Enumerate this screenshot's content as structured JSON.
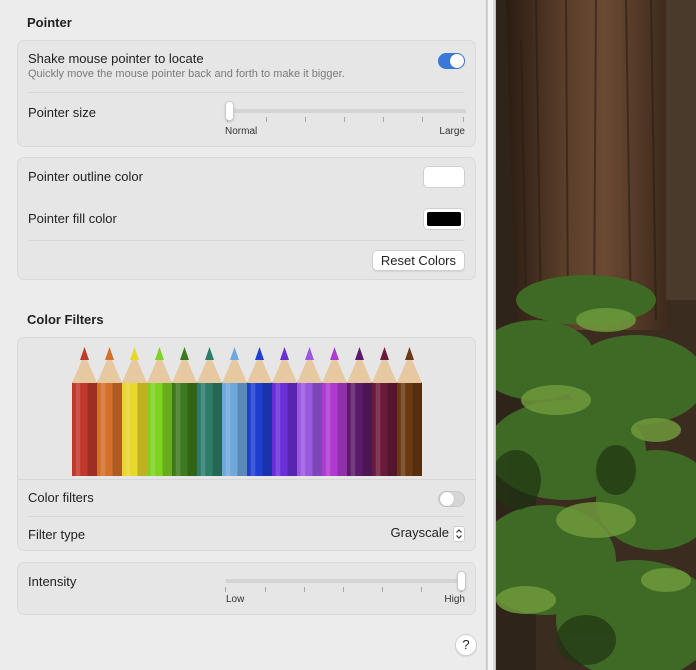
{
  "pointer": {
    "title": "Pointer",
    "shake": {
      "label": "Shake mouse pointer to locate",
      "description": "Quickly move the mouse pointer back and forth to make it bigger.",
      "enabled": true
    },
    "size": {
      "label": "Pointer size",
      "min_label": "Normal",
      "max_label": "Large",
      "value_fraction": 0.0
    },
    "outline": {
      "label": "Pointer outline color",
      "color": "#ffffff"
    },
    "fill": {
      "label": "Pointer fill color",
      "color": "#000000"
    },
    "reset_label": "Reset Colors"
  },
  "color_filters": {
    "title": "Color Filters",
    "pencil_colors": [
      "#c0392b",
      "#d3702a",
      "#e8d82a",
      "#7ed321",
      "#3d7a1e",
      "#2e7d6b",
      "#6fa8dc",
      "#1f3fd0",
      "#6a2fd8",
      "#9a57e0",
      "#b03ad0",
      "#5c1a6a",
      "#6a1a3a",
      "#6b3a12"
    ],
    "toggle": {
      "label": "Color filters",
      "enabled": false
    },
    "filter_type": {
      "label": "Filter type",
      "value": "Grayscale"
    },
    "intensity": {
      "label": "Intensity",
      "min_label": "Low",
      "max_label": "High",
      "value_fraction": 1.0
    }
  },
  "help_label": "?",
  "icons": {
    "help": "help-icon",
    "stepper": "chevron-updown-icon",
    "toggle": "toggle-switch"
  }
}
